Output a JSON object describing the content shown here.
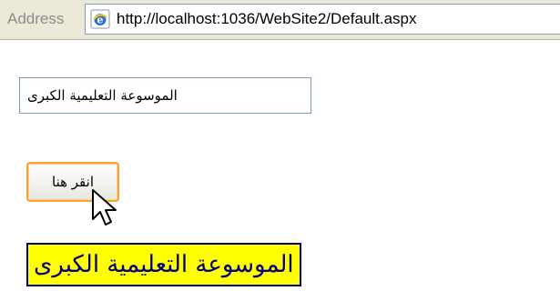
{
  "browser": {
    "address_label": "Address",
    "url": "http://localhost:1036/WebSite2/Default.aspx",
    "icon": "ie-page-icon"
  },
  "form": {
    "textbox_value": "الموسوعة التعليمية الكبرى",
    "button_label": "انقر هنا",
    "result_text": "الموسوعة التعليمية الكبرى"
  },
  "colors": {
    "label_background": "#ffff00",
    "label_text": "#000080",
    "button_focus_border": "#f6a533"
  }
}
